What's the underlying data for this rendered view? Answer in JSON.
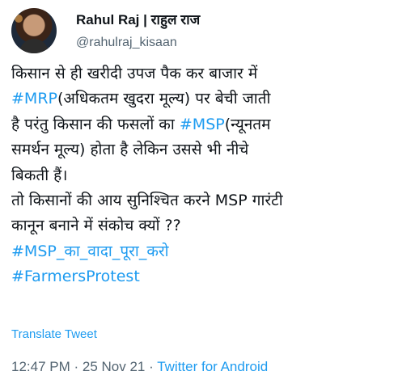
{
  "author": {
    "display_name": "Rahul Raj | राहुल राज",
    "handle": "@rahulraj_kisaan"
  },
  "tweet": {
    "lines": [
      [
        {
          "t": "किसान से ही खरीदी उपज पैक कर बाजार में"
        }
      ],
      [
        {
          "t": "#MRP",
          "tag": true
        },
        {
          "t": "(अधिकतम खुदरा मूल्य) पर बेची जाती"
        }
      ],
      [
        {
          "t": "है परंतु किसान की फसलों का "
        },
        {
          "t": "#MSP",
          "tag": true
        },
        {
          "t": "(न्यूनतम"
        }
      ],
      [
        {
          "t": "समर्थन मूल्य) होता है लेकिन उससे भी नीचे"
        }
      ],
      [
        {
          "t": "बिकती हैं।"
        }
      ],
      [
        {
          "t": "तो किसानों की आय सुनिश्चित करने MSP गारंटी"
        }
      ],
      [
        {
          "t": "कानून बनाने में संकोच क्यों ??"
        }
      ],
      [
        {
          "t": "#MSP_का_वादा_पूरा_करो",
          "tag": true
        }
      ],
      [
        {
          "t": "#FarmersProtest",
          "tag": true
        }
      ]
    ],
    "translate_label": "Translate Tweet",
    "time": "12:47 PM",
    "date": "25 Nov 21",
    "source": "Twitter for Android",
    "separator": " · "
  },
  "colors": {
    "link": "#1d9bf0",
    "text": "#0f1419",
    "muted": "#536471"
  }
}
